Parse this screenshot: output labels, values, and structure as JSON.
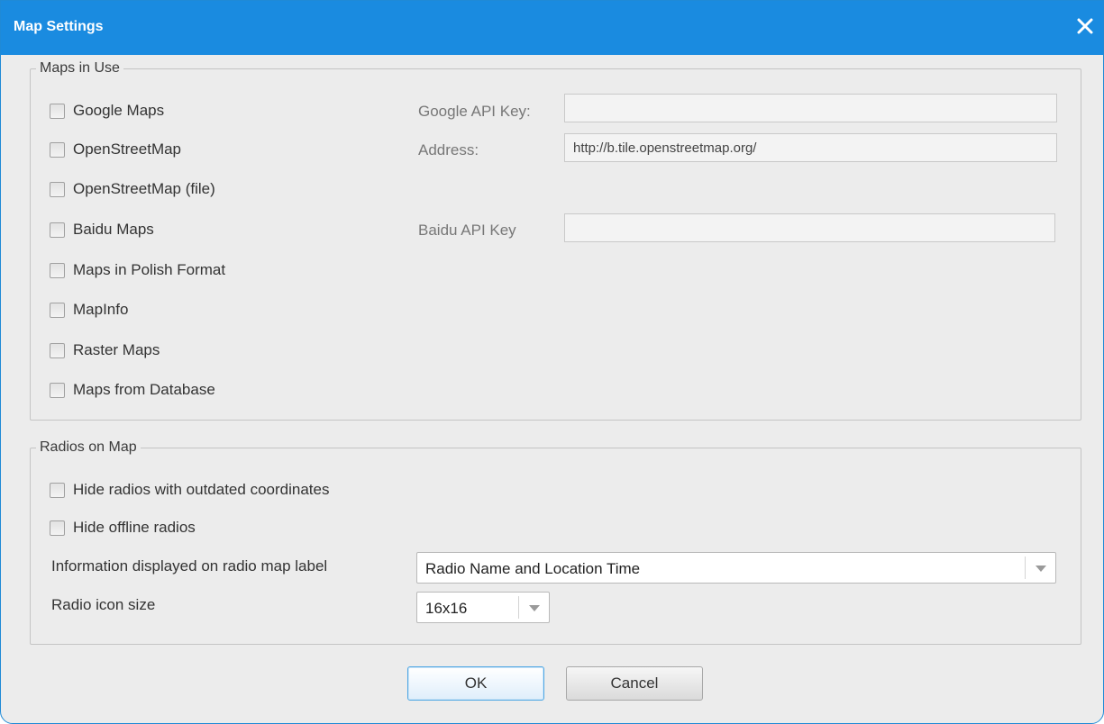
{
  "window": {
    "title": "Map Settings"
  },
  "maps_in_use": {
    "legend": "Maps in Use",
    "options": [
      {
        "label": "Google Maps",
        "checked": false
      },
      {
        "label": "OpenStreetMap",
        "checked": false
      },
      {
        "label": "OpenStreetMap (file)",
        "checked": false
      },
      {
        "label": "Baidu Maps",
        "checked": false
      },
      {
        "label": "Maps in Polish Format",
        "checked": false
      },
      {
        "label": "MapInfo",
        "checked": false
      },
      {
        "label": "Raster Maps",
        "checked": false
      },
      {
        "label": "Maps from Database",
        "checked": false
      }
    ],
    "google_api_key": {
      "label": "Google API Key:",
      "value": ""
    },
    "address": {
      "label": "Address:",
      "value": "http://b.tile.openstreetmap.org/"
    },
    "baidu_api_key": {
      "label": "Baidu API Key",
      "value": ""
    }
  },
  "radios_on_map": {
    "legend": "Radios on Map",
    "options": [
      {
        "label": "Hide radios with outdated coordinates",
        "checked": false
      },
      {
        "label": "Hide offline radios",
        "checked": false
      }
    ],
    "label_info": {
      "label": "Information displayed on radio map label",
      "value": "Radio Name and Location Time"
    },
    "icon_size": {
      "label": "Radio icon size",
      "value": "16x16"
    }
  },
  "buttons": {
    "ok": "OK",
    "cancel": "Cancel"
  }
}
